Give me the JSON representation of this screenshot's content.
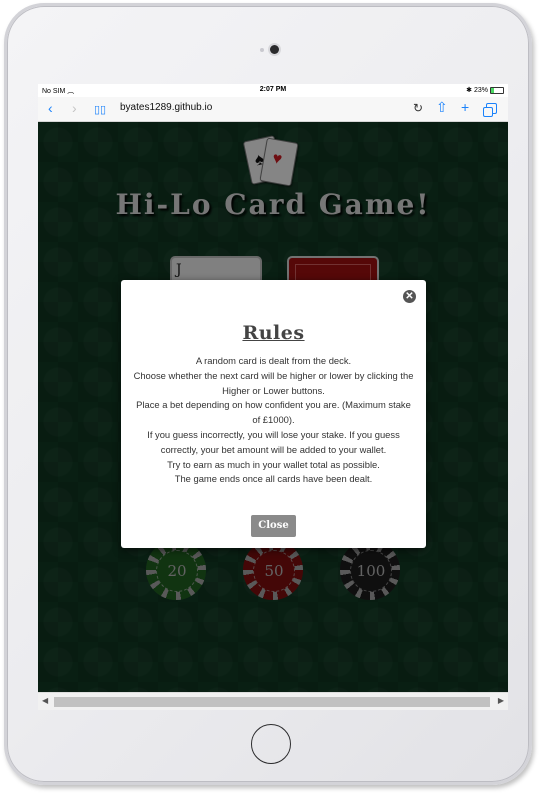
{
  "status": {
    "carrier": "No SIM",
    "time": "2:07 PM",
    "battery": "23%"
  },
  "browser": {
    "url": "byates1289.github.io"
  },
  "game": {
    "title": "Hi-Lo Card Game!",
    "left_card_rank": "J"
  },
  "modal": {
    "title": "Rules",
    "lines": [
      "A random card is dealt from the deck.",
      "Choose whether the next card will be higher or lower by clicking the Higher or Lower buttons.",
      "Place a bet depending on how confident you are. (Maximum stake of £1000).",
      "If you guess incorrectly, you will lose your stake. If you guess correctly, your bet amount will be added to your wallet.",
      "Try to earn as much in your wallet total as possible.",
      "The game ends once all cards have been dealt."
    ],
    "close_label": "Close"
  },
  "chips": [
    {
      "value": "20",
      "color": "#2f8a2f"
    },
    {
      "value": "50",
      "color": "#b21414"
    },
    {
      "value": "100",
      "color": "#2a2a2a"
    }
  ]
}
